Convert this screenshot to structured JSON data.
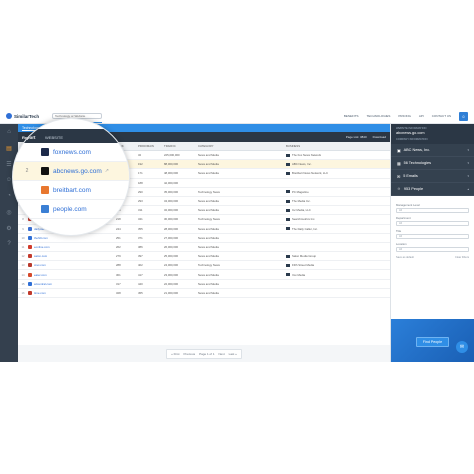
{
  "topnav": {
    "brand": "SimilarTech",
    "search_placeholder": "Technology or Website",
    "links": [
      "BENEFITS",
      "TECHNOLOGIES",
      "PRICING",
      "API",
      "CONTACT US"
    ],
    "avatar_glyph": "☺"
  },
  "sidebar": {
    "icons": [
      "home-icon",
      "reports-icon",
      "list-icon",
      "users-icon",
      "pie-icon",
      "globe-icon",
      "settings-icon",
      "help-icon"
    ]
  },
  "tabs": [
    "Technology Reports",
    "Report 90903"
  ],
  "report_header": {
    "title": "Report",
    "page_list": "Page List: 3840",
    "download": "Download"
  },
  "table": {
    "columns": [
      "",
      "WEBSITE",
      "RANK",
      "PR/DOMAIN",
      "TRAFFIC",
      "CATEGORY",
      "BUSINESS"
    ],
    "rows": [
      {
        "num": "1",
        "site": "foxnews.com",
        "a": "22",
        "b": "32",
        "c": "225,000,000",
        "cat": "News and Media",
        "co": "The Fox News Network",
        "fav": "#1c2a4a"
      },
      {
        "num": "2",
        "site": "abcnews.go.com",
        "a": "116",
        "b": "192",
        "c": "88,000,000",
        "cat": "News and Media",
        "co": "ABC News, Inc.",
        "fav": "#111111"
      },
      {
        "num": "3",
        "site": "breitbart.com",
        "a": "170",
        "b": "171",
        "c": "48,000,000",
        "cat": "News and Media",
        "co": "Breitbart News Network, LLC",
        "fav": "#e8772e"
      },
      {
        "num": "4",
        "site": "people.com",
        "a": "137",
        "b": "188",
        "c": "42,000,000",
        "cat": "",
        "co": "",
        "fav": "#3b7fd4"
      },
      {
        "num": "5",
        "site": "pcmag.com",
        "a": "196",
        "b": "290",
        "c": "35,000,000",
        "cat": "Technology News",
        "co": "PC Magazine",
        "fav": "#d33a2c"
      },
      {
        "num": "6",
        "site": "avclub.com",
        "a": "205",
        "b": "293",
        "c": "34,000,000",
        "cat": "News and Media",
        "co": "The Media Inc.",
        "fav": "#c24b3a"
      },
      {
        "num": "7",
        "site": "springwise.com",
        "a": "210",
        "b": "311",
        "c": "32,000,000",
        "cat": "News and Media",
        "co": "Inc Media, LLC",
        "fav": "#d0402f"
      },
      {
        "num": "8",
        "site": "searchmetrics.com",
        "a": "218",
        "b": "341",
        "c": "30,000,000",
        "cat": "Technology News",
        "co": "Searchmetrics Inc.",
        "fav": "#c43a30"
      },
      {
        "num": "9",
        "site": "dailycaller.com",
        "a": "244",
        "b": "355",
        "c": "28,000,000",
        "cat": "News and Media",
        "co": "The Daily Caller, Inc.",
        "fav": "#3b6fd0"
      },
      {
        "num": "10",
        "site": "thehill.com",
        "a": "251",
        "b": "371",
        "c": "27,000,000",
        "cat": "News and Media",
        "co": "",
        "fav": "#2f6fd6"
      },
      {
        "num": "11",
        "site": "eonline.com",
        "a": "262",
        "b": "386",
        "c": "26,000,000",
        "cat": "News and Media",
        "co": "",
        "fav": "#d13b2b"
      },
      {
        "num": "12",
        "site": "salon.com",
        "a": "279",
        "b": "397",
        "c": "25,000,000",
        "cat": "News and Media",
        "co": "Salon Media Group",
        "fav": "#c33a2d"
      },
      {
        "num": "13",
        "site": "cnet.com",
        "a": "288",
        "b": "402",
        "c": "24,000,000",
        "cat": "Technology News",
        "co": "Fifth Street Media",
        "fav": "#b83a2e"
      },
      {
        "num": "14",
        "site": "eater.com",
        "a": "301",
        "b": "417",
        "c": "23,000,000",
        "cat": "News and Media",
        "co": "Vox Media",
        "fav": "#d54a2c"
      },
      {
        "num": "15",
        "site": "azcentral.com",
        "a": "317",
        "b": "440",
        "c": "22,000,000",
        "cat": "News and Media",
        "co": "",
        "fav": "#2f6fd6"
      },
      {
        "num": "16",
        "site": "time.com",
        "a": "328",
        "b": "455",
        "c": "21,000,000",
        "cat": "News and Media",
        "co": "",
        "fav": "#c0392b"
      }
    ]
  },
  "pagination": {
    "first": "« First",
    "prev": "Previous",
    "page": "Page 1 of 1",
    "next": "Next",
    "last": "Last »"
  },
  "right_panel": {
    "website_label": "WEBSITE INFORMATION",
    "website": "abcnews.go.com",
    "company_label": "COMPANY INFORMATION",
    "sections": [
      {
        "label": "ABC News, Inc.",
        "icon": "building-icon"
      },
      {
        "label": "56 Technologies",
        "icon": "chip-icon"
      },
      {
        "label": "5 Emails",
        "icon": "mail-icon"
      },
      {
        "label": "953 People",
        "icon": "people-icon"
      }
    ],
    "filters": [
      {
        "label": "Management Level",
        "value": "All"
      },
      {
        "label": "Department",
        "value": "All"
      },
      {
        "label": "Title",
        "value": "All"
      },
      {
        "label": "Location",
        "value": "All"
      }
    ],
    "link_left": "Save as default",
    "link_right": "Clear Filters",
    "find_button": "Find People",
    "chat_glyph": "✉"
  },
  "magnifier": {
    "report_label": "Report",
    "column_label": "WEBSITE",
    "rows": [
      {
        "num": "",
        "site": "foxnews.com",
        "fav": "#1c2a4a"
      },
      {
        "num": "2",
        "site": "abcnews.go.com",
        "fav": "#111111"
      },
      {
        "num": "",
        "site": "breitbart.com",
        "fav": "#e8772e"
      },
      {
        "num": "",
        "site": "people.com",
        "fav": "#3b7fd4"
      }
    ]
  }
}
